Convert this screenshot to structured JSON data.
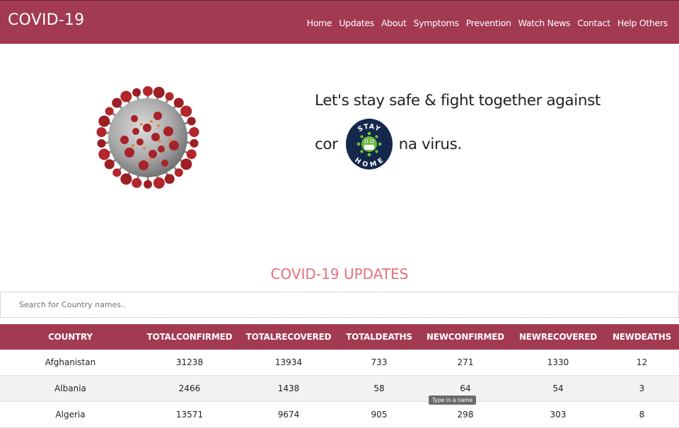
{
  "brand": "COVID-19",
  "nav": [
    "Home",
    "Updates",
    "About",
    "Symptoms",
    "Prevention",
    "Watch News",
    "Contact",
    "Help Others"
  ],
  "hero": {
    "line1": "Let's stay safe & fight together against",
    "line2_before": "cor",
    "line2_after": "na virus.",
    "badge_top": "STAY",
    "badge_bottom": "HOME"
  },
  "updates": {
    "title": "COVID-19 UPDATES",
    "search_placeholder": "Search for Country names..",
    "columns": [
      "COUNTRY",
      "TOTALCONFIRMED",
      "TOTALRECOVERED",
      "TOTALDEATHS",
      "NEWCONFIRMED",
      "NEWRECOVERED",
      "NEWDEATHS"
    ],
    "rows": [
      [
        "Afghanistan",
        "31238",
        "13934",
        "733",
        "271",
        "1330",
        "12"
      ],
      [
        "Albania",
        "2466",
        "1438",
        "58",
        "64",
        "54",
        "3"
      ],
      [
        "Algeria",
        "13571",
        "9674",
        "905",
        "298",
        "303",
        "8"
      ]
    ]
  },
  "tooltip": "Type in a name",
  "colors": {
    "primary": "#a23a51",
    "title_accent": "#e7707c",
    "badge_navy": "#13284b",
    "badge_green": "#6bbf3a"
  }
}
